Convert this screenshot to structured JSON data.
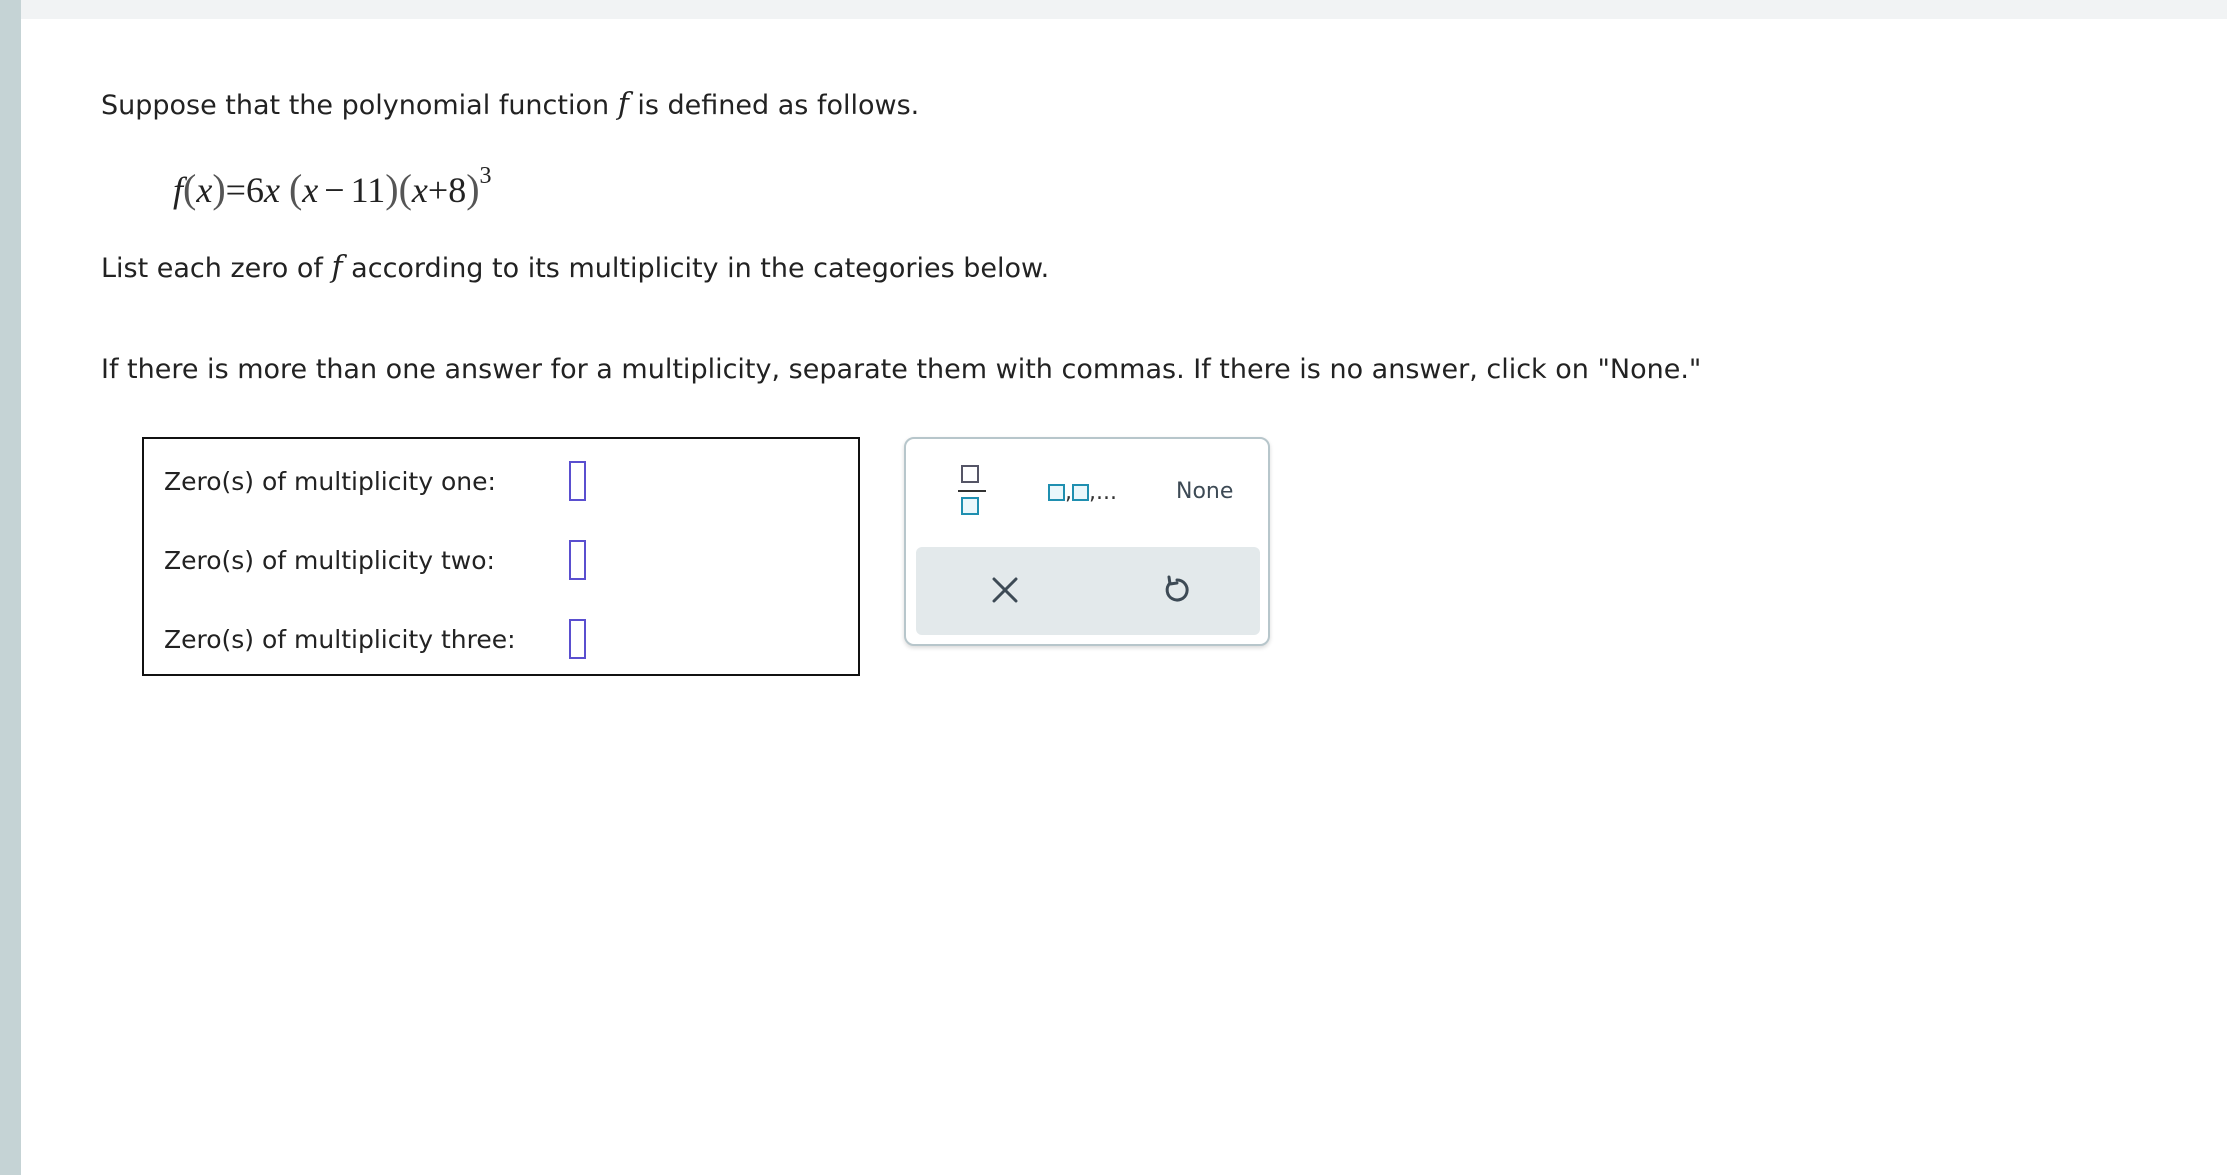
{
  "problem": {
    "intro_before": "Suppose that the polynomial function ",
    "intro_var": "f",
    "intro_after": " is defined as follows.",
    "formula": {
      "fname": "f",
      "lparen1": "(",
      "arg": "x",
      "rparen1": ")",
      "equals": "=",
      "coef": "6",
      "coefvar": "x",
      "f1_open": "(",
      "f1_var": "x",
      "f1_op": "−",
      "f1_const": "11",
      "f1_close": ")",
      "f2_open": "(",
      "f2_var": "x",
      "f2_op": "+",
      "f2_const": "8",
      "f2_close": ")",
      "f2_exp": "3"
    },
    "list_before": "List each zero of ",
    "list_var": "f",
    "list_after": " according to its multiplicity in the categories below.",
    "instructions": "If there is more than one answer for a multiplicity, separate them with commas. If there is no answer, click on \"None.\""
  },
  "answers": {
    "rows": [
      {
        "label": "Zero(s) of multiplicity one:",
        "value": ""
      },
      {
        "label": "Zero(s) of multiplicity two:",
        "value": ""
      },
      {
        "label": "Zero(s) of multiplicity three:",
        "value": ""
      }
    ]
  },
  "keypad": {
    "list_ellipsis": ",...",
    "list_sep": ",",
    "none_label": "None",
    "clear_icon": "close-icon",
    "undo_icon": "undo-icon"
  },
  "colors": {
    "input_border": "#5a4fcf",
    "keypad_accent": "#1f8fb0",
    "keypad_bottom_bg": "#e3e9eb",
    "left_rail": "#c5d3d5"
  }
}
